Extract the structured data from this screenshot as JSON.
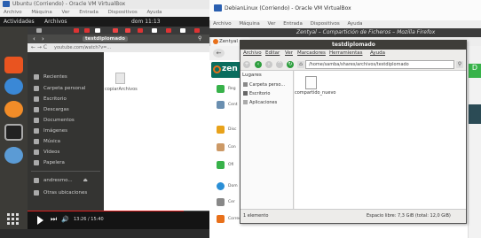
{
  "vm1": {
    "title": "Ubuntu (Corriendo) - Oracle VM VirtualBox",
    "menu": [
      "Archivo",
      "Máquina",
      "Ver",
      "Entrada",
      "Dispositivos",
      "Ayuda"
    ],
    "activities": "Actividades",
    "app_menu": "Archivos",
    "clock": "dom 11:13",
    "path_segment": "testdiplomado",
    "url": "youtube.com/watch?v=..."
  },
  "nautilus1": {
    "sidebar": [
      "Recientes",
      "Carpeta personal",
      "Escritorio",
      "Descargas",
      "Documentos",
      "Imágenes",
      "Música",
      "Vídeos",
      "Papelera",
      "andresmo...",
      "Otras ubicaciones"
    ],
    "file_label": "copiarArchivos"
  },
  "player": {
    "time": "13:26 / 15:40",
    "progress_fraction": 0.86
  },
  "vm2": {
    "title": "DebianLinux (Corriendo) - Oracle VM VirtualBox",
    "menu": [
      "Archivo",
      "Máquina",
      "Ver",
      "Entrada",
      "Dispositivos",
      "Ayuda"
    ],
    "minimize": "–",
    "maximize": "□",
    "close": "✕",
    "firefox_title": "Zentyal – Compartición de Ficheros – Mozilla Firefox",
    "tab_label": "Zentyal",
    "logo_text": "zen",
    "right_letter": "D",
    "side_items": [
      "Reg",
      "Cent",
      "Disc",
      "Con",
      "Ofi",
      "Dom",
      "Cer",
      "Correo"
    ]
  },
  "file_manager": {
    "title": "testdiplomado",
    "menu": [
      "Archivo",
      "Editar",
      "Ver",
      "Marcadores",
      "Herramientas",
      "Ayuda"
    ],
    "location": "/home/samba/shares/archivos/testdiplomado",
    "places_header": "Lugares",
    "places": [
      "Carpeta perso...",
      "Escritorio",
      "Aplicaciones"
    ],
    "file_name": "compartido_nuevo",
    "status_left": "1 elemento",
    "status_right": "Espacio libre: 7,3 GiB (total: 12,0 GiB)"
  },
  "colors": {
    "ubuntu_dock": "#3c3b37",
    "youtube_red": "#e02020",
    "zentyal_green": "#0a6d5e",
    "firefox_orange": "#e8701a"
  }
}
